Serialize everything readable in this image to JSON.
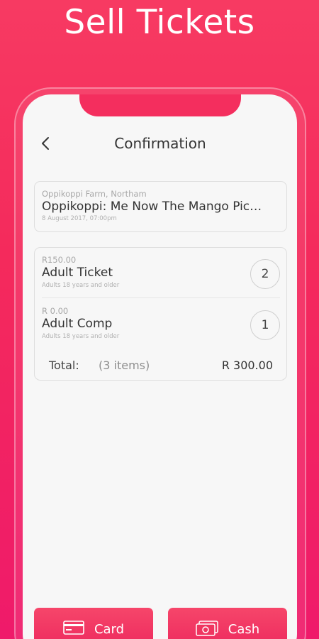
{
  "header": {
    "title": "Sell Tickets"
  },
  "nav": {
    "title": "Confirmation",
    "back_icon": "chevron-left-icon"
  },
  "event": {
    "venue": "Oppikoppi Farm, Northam",
    "name": "Oppikoppi: Me Now The Mango Pic…",
    "datetime": "8 August 2017, 07:00pm"
  },
  "tickets": [
    {
      "price": "R150.00",
      "name": "Adult Ticket",
      "description": "Adults 18 years and older",
      "quantity": "2"
    },
    {
      "price": "R 0.00",
      "name": "Adult Comp",
      "description": "Adults 18 years and older",
      "quantity": "1"
    }
  ],
  "total": {
    "label": "Total:",
    "items": "(3 items)",
    "amount": "R 300.00"
  },
  "payment": {
    "card_label": "Card",
    "card_icon": "credit-card-icon",
    "cash_label": "Cash",
    "cash_icon": "cash-icon"
  },
  "colors": {
    "brand": "#f42e5e",
    "screen_bg": "#f7f7f7"
  }
}
